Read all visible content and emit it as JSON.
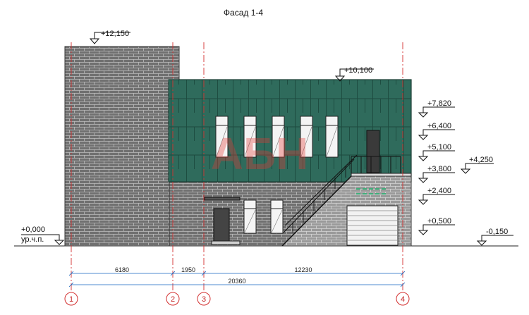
{
  "title": "Фасад 1-4",
  "levels": {
    "top_left": "+12,150",
    "roof": "+10,100",
    "l7820": "+7,820",
    "l6400": "+6,400",
    "l5100": "+5,100",
    "l4250": "+4,250",
    "l3800": "+3,800",
    "l2400": "+2,400",
    "l0500": "+0,500",
    "l_neg150": "-0,150",
    "zero": "+0,000",
    "zero_note": "ур.ч.п."
  },
  "dimensions": {
    "d1": "6180",
    "d2": "1950",
    "d3": "12230",
    "total": "20360"
  },
  "axes": [
    "1",
    "2",
    "3",
    "4"
  ],
  "watermark": "АБН",
  "colors": {
    "brick": "#6f6f6f",
    "panel": "#2e6b5b",
    "axis": "#d32f2f"
  }
}
